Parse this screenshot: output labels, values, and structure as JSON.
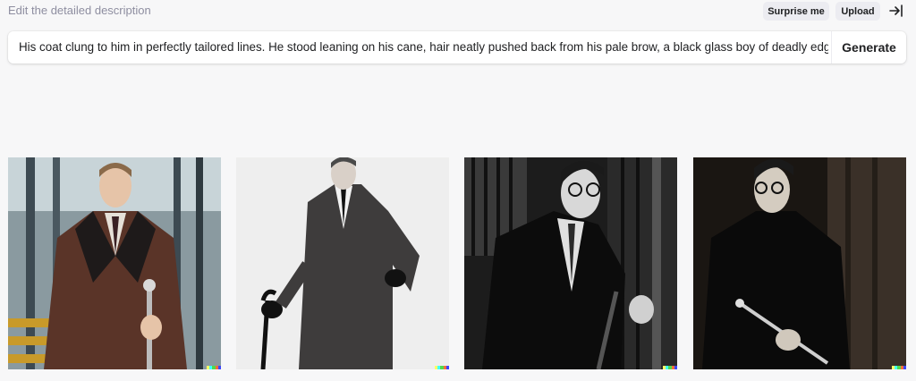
{
  "header": {
    "hint": "Edit the detailed description",
    "surprise_label": "Surprise me",
    "upload_label": "Upload",
    "collapse_icon": "collapse-right-icon"
  },
  "prompt": {
    "text": "His coat clung to him in perfectly tailored lines. He stood leaning on his cane, hair neatly pushed back from his pale brow, a black glass boy of deadly edges",
    "generate_label": "Generate"
  },
  "results": [
    {
      "subject": "man in brown tweed overcoat holding a cane, corridor with windows"
    },
    {
      "subject": "man in dark long coat leaning on cane, white background"
    },
    {
      "subject": "man with glasses in black coat, dark interior"
    },
    {
      "subject": "man with glasses in black coat holding cane, sepia dark"
    }
  ],
  "colors": {
    "background": "#f7f7f8",
    "strip": [
      "#ffff66",
      "#42ffff",
      "#51da4c",
      "#ff6e3c",
      "#3c46ff"
    ]
  }
}
